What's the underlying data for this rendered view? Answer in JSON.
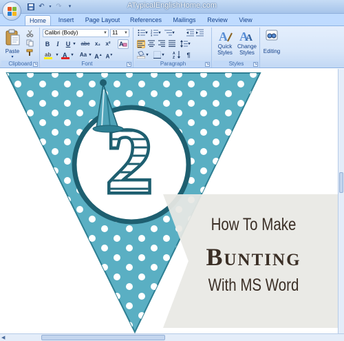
{
  "window": {
    "title": "ATypicalEnglishHome.com"
  },
  "tabs": [
    {
      "label": "Home",
      "active": true
    },
    {
      "label": "Insert"
    },
    {
      "label": "Page Layout"
    },
    {
      "label": "References"
    },
    {
      "label": "Mailings"
    },
    {
      "label": "Review"
    },
    {
      "label": "View"
    }
  ],
  "ribbon": {
    "clipboard": {
      "label": "Clipboard",
      "paste_label": "Paste"
    },
    "font": {
      "label": "Font",
      "font_name": "Calibri (Body)",
      "font_size": "11"
    },
    "paragraph": {
      "label": "Paragraph"
    },
    "styles": {
      "label": "Styles",
      "quick_styles": "Quick Styles",
      "change_styles": "Change Styles"
    },
    "editing": {
      "label": "Editing"
    }
  },
  "document": {
    "numeral": "2"
  },
  "overlay": {
    "line1": "How To Make",
    "line2": "Bunting",
    "line3": "With MS Word"
  },
  "colors": {
    "pennant": "#5aafc3",
    "pennant_dark": "#1e5f70",
    "circle_border": "#1e5f70",
    "ribbon_bg": "#d7e6f9",
    "title_text": "#ffffff",
    "overlay_text": "#3b2f26"
  },
  "icons": {
    "office_button": "office-logo",
    "save": "save-icon",
    "undo": "undo-icon",
    "redo": "redo-icon",
    "paste": "clipboard-icon",
    "cut": "scissors-icon",
    "copy": "copy-icon",
    "format_painter": "brush-icon",
    "quick_styles": "styles-a-icon",
    "change_styles": "change-styles-icon",
    "editing": "binoculars-icon",
    "party_hat": "party-hat"
  }
}
